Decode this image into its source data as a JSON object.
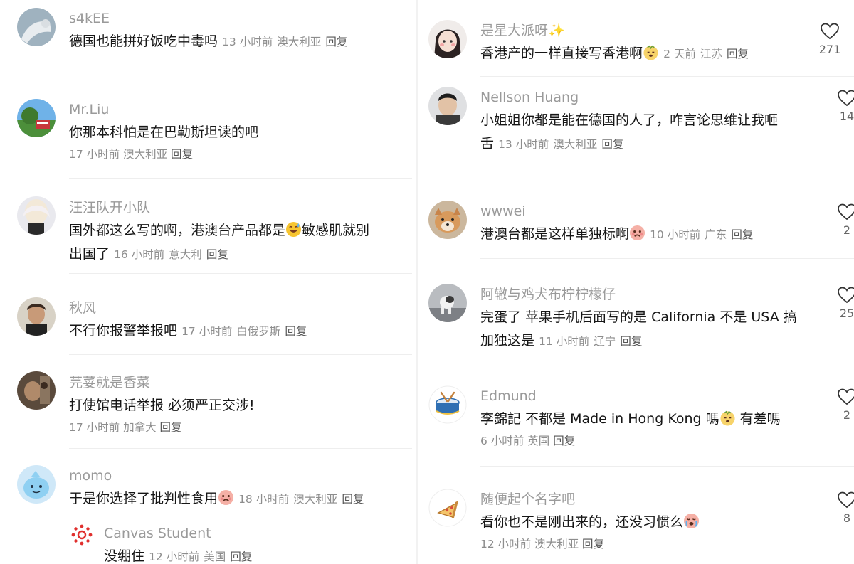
{
  "left": [
    {
      "user": "s4kEE",
      "text": "德国也能拼好饭吃中毒吗",
      "time": "13 小时前",
      "loc": "澳大利亚",
      "reply": "回复"
    },
    {
      "user": "Mr.Liu",
      "text": "你那本科怕是在巴勒斯坦读的吧",
      "time": "17 小时前",
      "loc": "澳大利亚",
      "reply": "回复"
    },
    {
      "user": "汪汪队开小队",
      "text_a": "国外都这么写的啊，港澳台产品都是",
      "text_b": "敏感肌就别",
      "text_c": "出国了",
      "time": "16 小时前",
      "loc": "意大利",
      "reply": "回复",
      "emoji": "sweat-smile-emoji"
    },
    {
      "user": "秋风",
      "text": "不行你报警举报吧",
      "time": "17 小时前",
      "loc": "白俄罗斯",
      "reply": "回复"
    },
    {
      "user": "芫荽就是香菜",
      "text": "打使馆电话举报 必须严正交涉!",
      "time": "17 小时前",
      "loc": "加拿大",
      "reply": "回复"
    },
    {
      "user": "momo",
      "text": "于是你选择了批判性食用",
      "time": "18 小时前",
      "loc": "澳大利亚",
      "reply": "回复",
      "emoji": "sad-emoji"
    },
    {
      "user": "Canvas Student",
      "text": "没绷住",
      "time": "12 小时前",
      "loc": "美国",
      "reply": "回复"
    }
  ],
  "right": [
    {
      "user": "是星大派呀✨",
      "text": "香港产的一样直接写香港啊",
      "time": "2 天前",
      "loc": "江苏",
      "reply": "回复",
      "likes": "271",
      "emoji": "smirk-emoji"
    },
    {
      "user": "Nellson Huang",
      "text_a": "小姐姐你都是能在德国的人了，咋言论思维让我咂",
      "text_b": "舌",
      "time": "13 小时前",
      "loc": "澳大利亚",
      "reply": "回复",
      "likes": "14"
    },
    {
      "user": "wwwei",
      "text": "港澳台都是这样单独标啊",
      "time": "10 小时前",
      "loc": "广东",
      "reply": "回复",
      "likes": "2",
      "emoji": "sad-emoji"
    },
    {
      "user": "阿辙与鸡犬布柠柠檬仔",
      "text_a": "完蛋了 苹果手机后面写的是 California 不是 USA 搞",
      "text_b": "加独这是",
      "time": "11 小时前",
      "loc": "辽宁",
      "reply": "回复",
      "likes": "25"
    },
    {
      "user": "Edmund",
      "text_a": "李錦記 不都是 Made in Hong Kong 嗎",
      "text_b": "有差嗎",
      "time": "6 小时前",
      "loc": "英国",
      "reply": "回复",
      "likes": "2",
      "emoji": "smirk-emoji"
    },
    {
      "user": "随便起个名字吧",
      "text": "看你也不是刚出来的，还没习惯么",
      "time": "12 小时前",
      "loc": "澳大利亚",
      "reply": "回复",
      "likes": "8",
      "emoji": "crying-emoji"
    }
  ]
}
